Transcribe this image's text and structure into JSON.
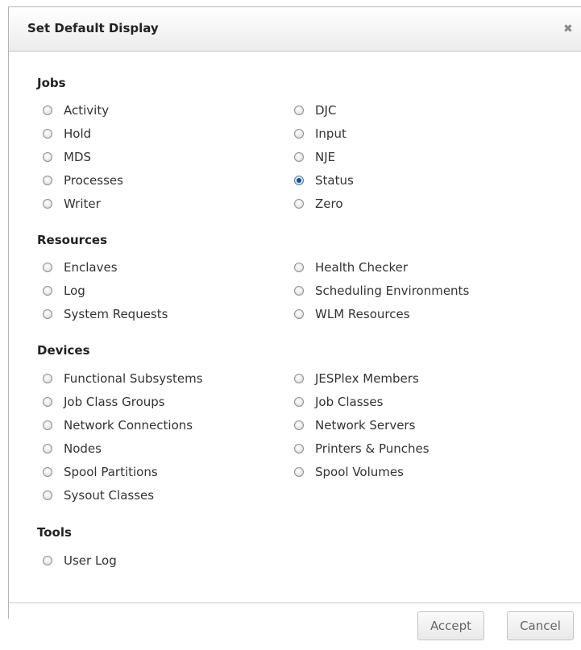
{
  "dialog": {
    "title": "Set Default Display",
    "close_icon": "close-icon"
  },
  "sections": {
    "jobs": {
      "title": "Jobs",
      "options": [
        "Activity",
        "Hold",
        "MDS",
        "Processes",
        "Writer",
        "DJC",
        "Input",
        "NJE",
        "Status",
        "Zero"
      ]
    },
    "resources": {
      "title": "Resources",
      "options": [
        "Enclaves",
        "Log",
        "System Requests",
        "Health Checker",
        "Scheduling Environments",
        "WLM Resources"
      ]
    },
    "devices": {
      "title": "Devices",
      "options": [
        "Functional Subsystems",
        "Job Class Groups",
        "Network Connections",
        "Nodes",
        "Spool Partitions",
        "Sysout Classes",
        "JESPlex Members",
        "Job Classes",
        "Network Servers",
        "Printers & Punches",
        "Spool Volumes"
      ]
    },
    "tools": {
      "title": "Tools",
      "options": [
        "User Log"
      ]
    }
  },
  "selected": "Status",
  "footer": {
    "accept_label": "Accept",
    "cancel_label": "Cancel"
  }
}
